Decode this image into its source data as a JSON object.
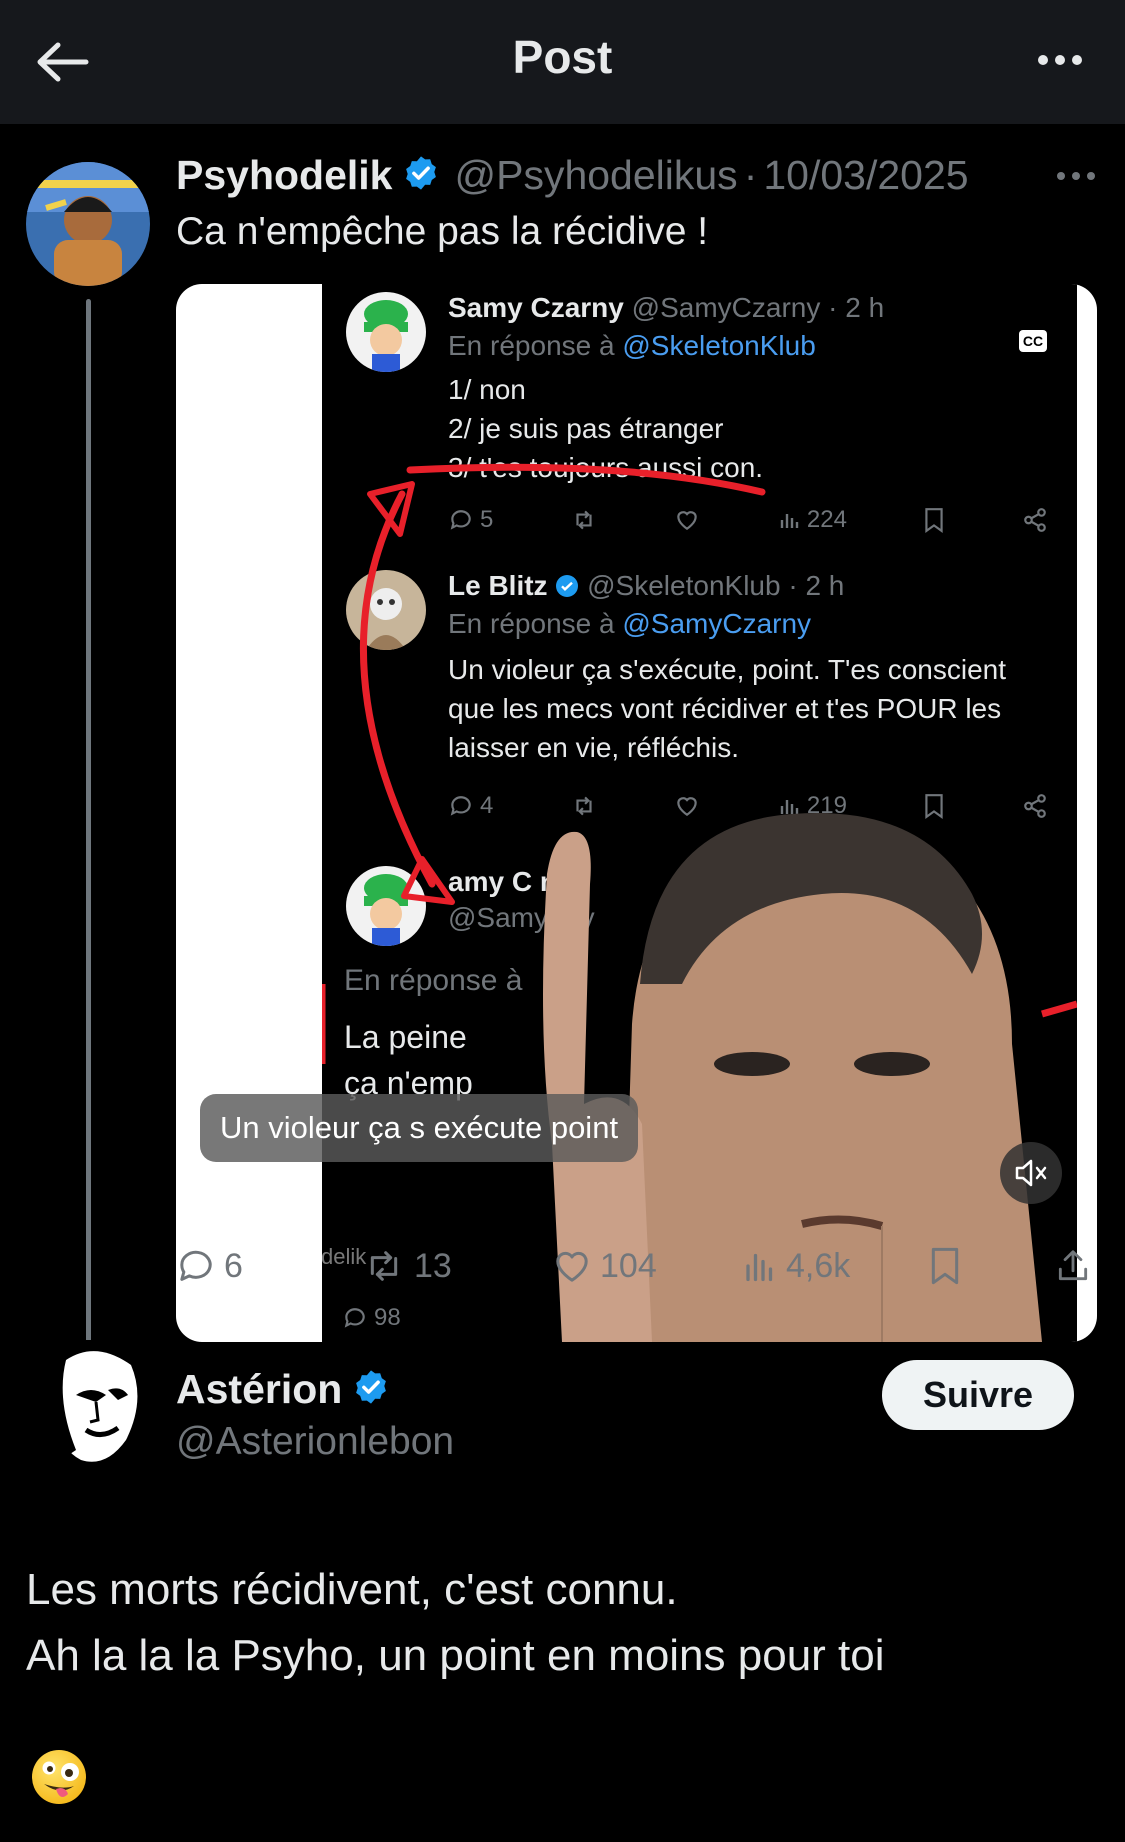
{
  "header": {
    "title": "Post"
  },
  "quoted_post": {
    "author_name": "Psyhodelik",
    "author_handle": "@Psyhodelikus",
    "separator": "·",
    "date": "10/03/2025",
    "text": "Ca n'empêche pas la récidive !",
    "video": {
      "cc_label": "CC",
      "subtitle": "Un violeur ça s exécute point",
      "tweet1": {
        "name": "Samy Czarny",
        "handle": "@SamyCzarny · 2 h",
        "reply_prefix": "En réponse à",
        "reply_to": "@SkeletonKlub",
        "body": "1/ non\n2/ je suis pas étranger\n3/ t'es toujours aussi con.",
        "replies": "5",
        "views": "224"
      },
      "tweet2": {
        "name": "Le Blitz",
        "handle": "@SkeletonKlub · 2 h",
        "reply_prefix": "En réponse à",
        "reply_to": "@SamyCzarny",
        "body": "Un violeur ça s'exécute, point. T'es conscient\nque les mecs vont récidiver et t'es POUR les\nlaisser en vie, réfléchis.",
        "replies": "4",
        "views": "219"
      },
      "tweet3": {
        "name": "amy C   ny",
        "handle": "@Samy   rny",
        "reply_prefix": "En réponse à",
        "body": "La peine\nça n'emp",
        "replies": "98"
      },
      "watermark": "@psyhodelik"
    },
    "stats": {
      "replies": "6",
      "reposts": "13",
      "likes": "104",
      "views": "4,6k"
    }
  },
  "reply_post": {
    "author_name": "Astérion",
    "author_handle": "@Asterionlebon",
    "follow_label": "Suivre",
    "text_line1": "Les morts récidivent, c'est connu.",
    "text_line2": "Ah la la la Psyho, un point en moins pour toi",
    "emoji": "zany-face"
  },
  "colors": {
    "verified": "#1d9bf0",
    "muted": "#71767b",
    "background": "#000000",
    "link": "#4a9df0",
    "annotation": "#e8202a"
  }
}
